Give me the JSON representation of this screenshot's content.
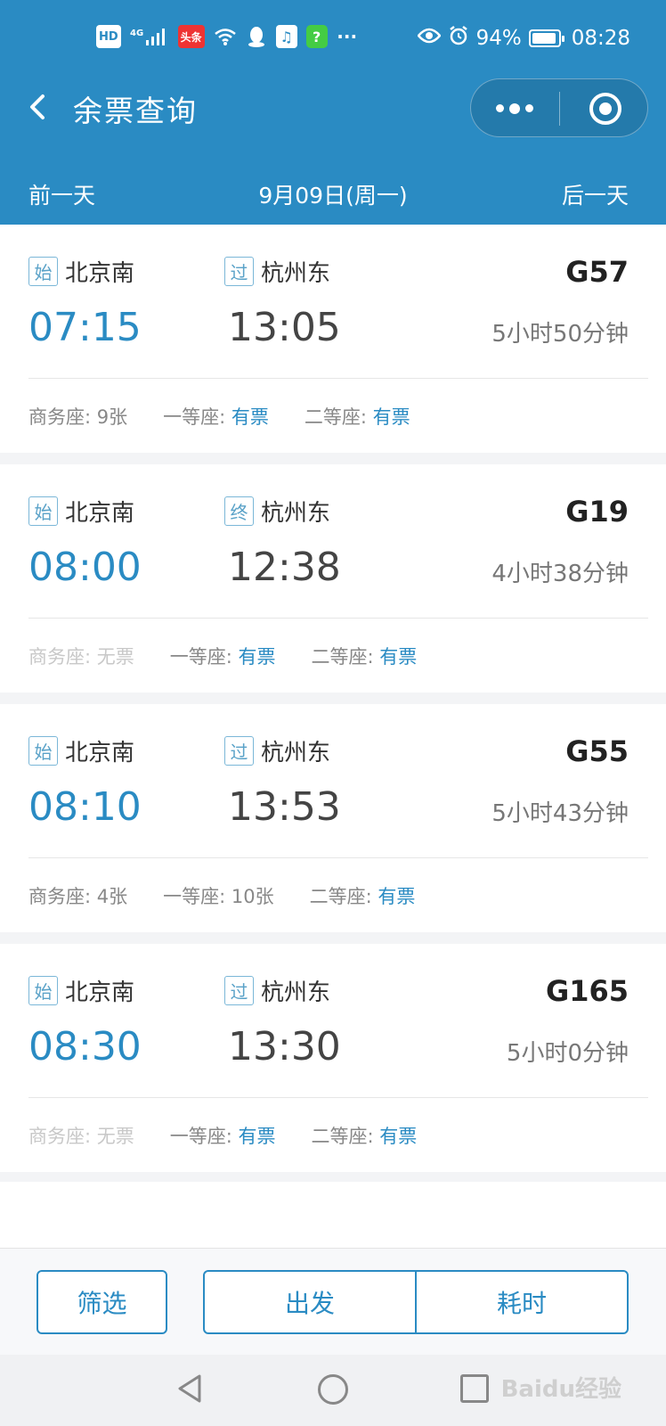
{
  "status_bar": {
    "hd": "HD",
    "signal": "4G",
    "news_app": "头条",
    "battery_percent": "94%",
    "battery_level": 0.94,
    "time": "08:28"
  },
  "nav": {
    "title": "余票查询"
  },
  "date_bar": {
    "prev_label": "前一天",
    "current_date": "9月09日(周一)",
    "next_label": "后一天"
  },
  "trains": [
    {
      "from_tag": "始",
      "from": "北京南",
      "to_tag": "过",
      "to": "杭州东",
      "number": "G57",
      "depart": "07:15",
      "arrive": "13:05",
      "duration": "5小时50分钟",
      "seats": [
        {
          "label": "商务座: ",
          "value": "9张",
          "state": "count"
        },
        {
          "label": "一等座: ",
          "value": "有票",
          "state": "avail"
        },
        {
          "label": "二等座: ",
          "value": "有票",
          "state": "avail"
        }
      ]
    },
    {
      "from_tag": "始",
      "from": "北京南",
      "to_tag": "终",
      "to": "杭州东",
      "number": "G19",
      "depart": "08:00",
      "arrive": "12:38",
      "duration": "4小时38分钟",
      "seats": [
        {
          "label": "商务座: ",
          "value": "无票",
          "state": "none"
        },
        {
          "label": "一等座: ",
          "value": "有票",
          "state": "avail"
        },
        {
          "label": "二等座: ",
          "value": "有票",
          "state": "avail"
        }
      ]
    },
    {
      "from_tag": "始",
      "from": "北京南",
      "to_tag": "过",
      "to": "杭州东",
      "number": "G55",
      "depart": "08:10",
      "arrive": "13:53",
      "duration": "5小时43分钟",
      "seats": [
        {
          "label": "商务座: ",
          "value": "4张",
          "state": "count"
        },
        {
          "label": "一等座: ",
          "value": "10张",
          "state": "count"
        },
        {
          "label": "二等座: ",
          "value": "有票",
          "state": "avail"
        }
      ]
    },
    {
      "from_tag": "始",
      "from": "北京南",
      "to_tag": "过",
      "to": "杭州东",
      "number": "G165",
      "depart": "08:30",
      "arrive": "13:30",
      "duration": "5小时0分钟",
      "seats": [
        {
          "label": "商务座: ",
          "value": "无票",
          "state": "none"
        },
        {
          "label": "一等座: ",
          "value": "有票",
          "state": "avail"
        },
        {
          "label": "二等座: ",
          "value": "有票",
          "state": "avail"
        }
      ]
    }
  ],
  "bottom_bar": {
    "filter_label": "筛选",
    "depart_label": "出发",
    "duration_label": "耗时"
  },
  "watermark": "Baidu经验",
  "colors": {
    "brand": "#2a8bc3",
    "available": "#2a8bc3",
    "unavailable": "#c8c8c8"
  }
}
